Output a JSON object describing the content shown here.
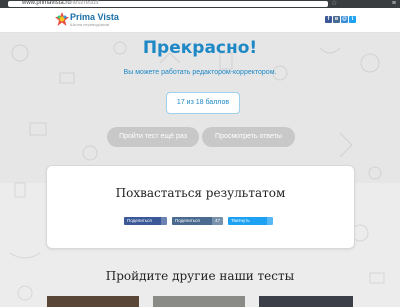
{
  "browser": {
    "url_host": "www.primavista.ru",
    "url_path": "/test/result"
  },
  "header": {
    "brand": "Prima Vista",
    "tagline": "Школа переводчиков"
  },
  "social_icons": [
    {
      "icon": "facebook-icon",
      "glyph": "f",
      "color": "#3b5998"
    },
    {
      "icon": "vk-icon",
      "glyph": "в",
      "color": "#4a6b8f"
    },
    {
      "icon": "mail-icon",
      "glyph": "@",
      "color": "#3a8ed8"
    },
    {
      "icon": "twitter-icon",
      "glyph": "t",
      "color": "#1da1f2"
    }
  ],
  "result": {
    "title": "Прекрасно!",
    "subtitle": "Вы можете работать редактором-корректором.",
    "score": "17 из 18 баллов"
  },
  "actions": {
    "retry": "Пройти тест ещё раз",
    "review": "Просмотреть ответы"
  },
  "share": {
    "title": "Похвастаться результатом",
    "buttons": [
      {
        "label": "Поделиться",
        "count": "",
        "color": "#3b5998",
        "icon": "facebook-icon"
      },
      {
        "label": "Поделиться",
        "count": "47",
        "color": "#4a6b8f",
        "icon": "vk-icon"
      },
      {
        "label": "Твитнуть",
        "count": "",
        "color": "#1da1f2",
        "icon": "twitter-icon"
      }
    ]
  },
  "other_tests": {
    "title": "Пройдите другие наши тесты"
  }
}
